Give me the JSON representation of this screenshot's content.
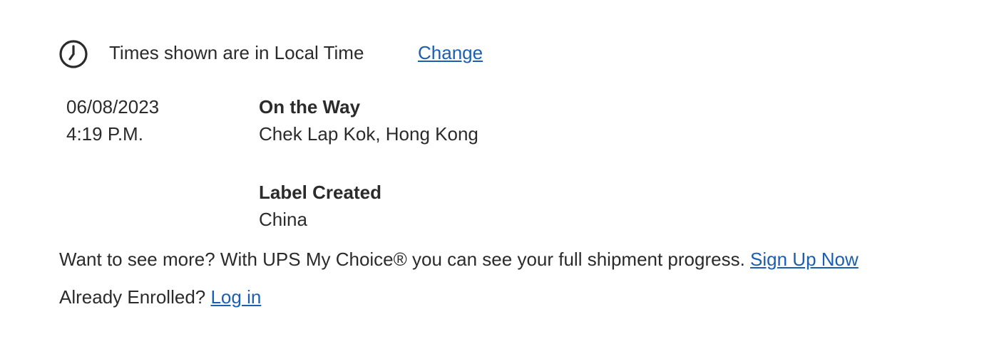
{
  "timezone": {
    "icon": "clock-icon",
    "text": "Times shown are in Local Time",
    "change_label": "Change"
  },
  "events": [
    {
      "date": "06/08/2023",
      "time": "4:19 P.M.",
      "status": "On the Way",
      "location": "Chek Lap Kok, Hong Kong"
    },
    {
      "date": "",
      "time": "",
      "status": "Label Created",
      "location": "China"
    }
  ],
  "promo": {
    "text": "Want to see more? With UPS My Choice® you can see your full shipment progress.",
    "link_label": "Sign Up Now"
  },
  "enrolled": {
    "text": "Already Enrolled?",
    "link_label": "Log in"
  },
  "colors": {
    "text": "#2b2b2b",
    "link": "#1a5fb4"
  }
}
